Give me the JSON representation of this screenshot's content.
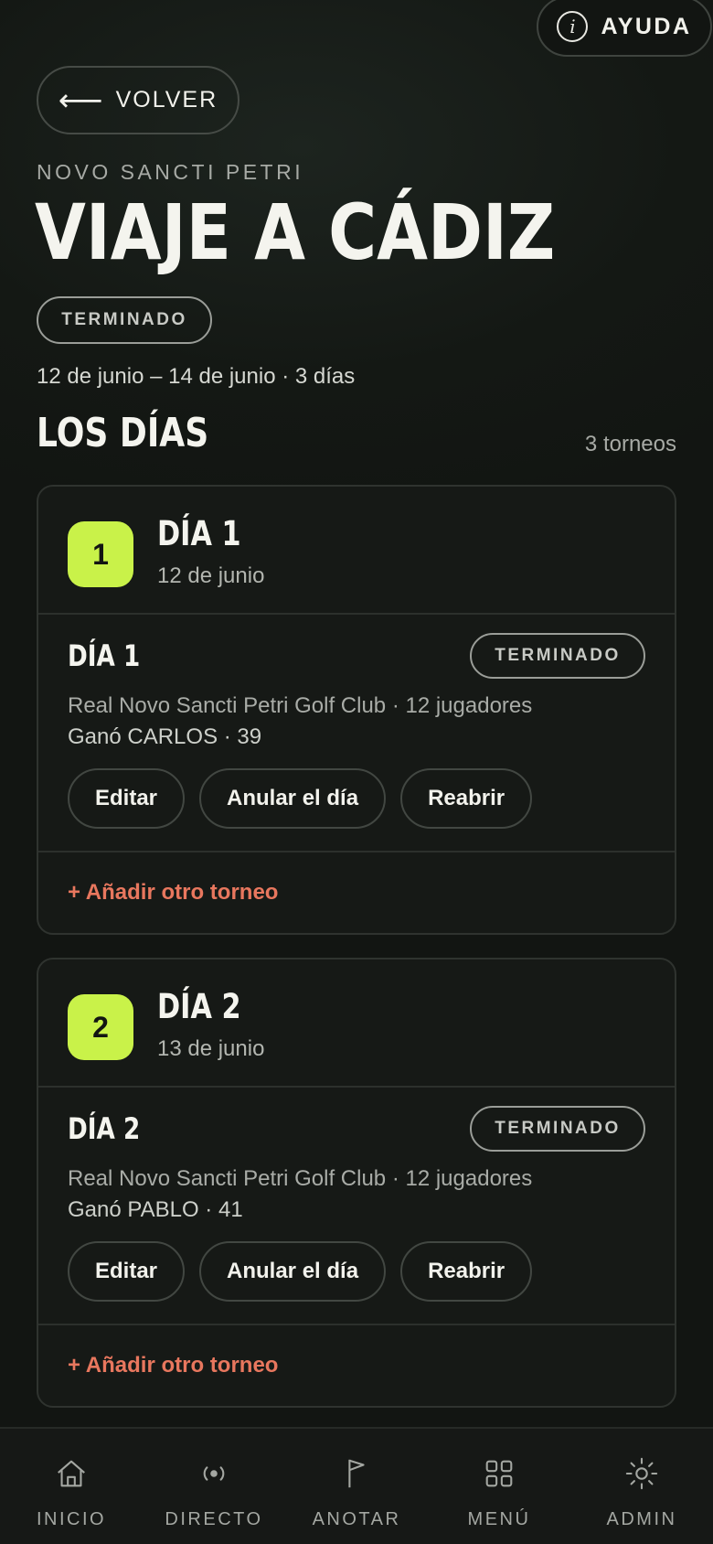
{
  "header": {
    "help_label": "AYUDA",
    "back_label": "VOLVER",
    "subtitle": "NOVO SANCTI PETRI",
    "title": "VIAJE A CÁDIZ",
    "status": "TERMINADO",
    "dates": "12 de junio – 14 de junio · 3 días"
  },
  "section": {
    "title": "LOS DÍAS",
    "count": "3 torneos"
  },
  "days": [
    {
      "number": "1",
      "name": "DÍA 1",
      "date": "12 de junio",
      "tournament": {
        "name": "DÍA 1",
        "status": "TERMINADO",
        "info": "Real Novo Sancti Petri Golf Club · 12 jugadores",
        "winner": "Ganó CARLOS · 39",
        "actions": {
          "edit": "Editar",
          "void": "Anular el día",
          "reopen": "Reabrir"
        }
      },
      "add_label": "+ Añadir otro torneo"
    },
    {
      "number": "2",
      "name": "DÍA 2",
      "date": "13 de junio",
      "tournament": {
        "name": "DÍA 2",
        "status": "TERMINADO",
        "info": "Real Novo Sancti Petri Golf Club · 12 jugadores",
        "winner": "Ganó PABLO · 41",
        "actions": {
          "edit": "Editar",
          "void": "Anular el día",
          "reopen": "Reabrir"
        }
      },
      "add_label": "+ Añadir otro torneo"
    }
  ],
  "nav": [
    {
      "label": "INICIO",
      "icon": "home-icon"
    },
    {
      "label": "DIRECTO",
      "icon": "live-icon"
    },
    {
      "label": "ANOTAR",
      "icon": "flag-icon"
    },
    {
      "label": "MENÚ",
      "icon": "grid-icon"
    },
    {
      "label": "ADMIN",
      "icon": "sun-icon"
    }
  ],
  "colors": {
    "accent": "#c9f249",
    "link": "#e8775e",
    "background": "#121512"
  }
}
